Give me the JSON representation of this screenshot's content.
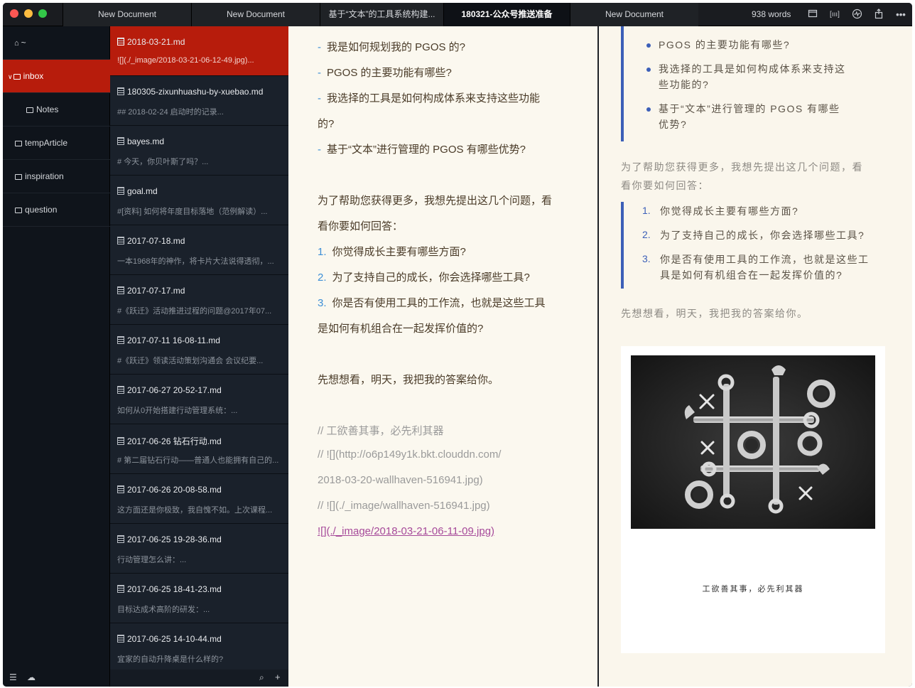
{
  "tabs": [
    {
      "label": "New Document"
    },
    {
      "label": "New Document"
    },
    {
      "label": "基于“文本”的工具系统构建..."
    },
    {
      "label": "180321-公众号推送准备"
    },
    {
      "label": "New Document"
    }
  ],
  "toolbar": {
    "word_count": "938 words",
    "icons": [
      "window-icon",
      "brackets-icon",
      "activity-icon",
      "share-icon",
      "more-icon"
    ]
  },
  "folders": [
    {
      "label": "~",
      "icon": "home-icon"
    },
    {
      "label": "inbox",
      "icon": "folder-icon"
    },
    {
      "label": "Notes",
      "icon": "folder-icon"
    },
    {
      "label": "tempArticle",
      "icon": "folder-icon"
    },
    {
      "label": "inspiration",
      "icon": "folder-icon"
    },
    {
      "label": "question",
      "icon": "folder-icon"
    }
  ],
  "files": [
    {
      "name": "2018-03-21.md",
      "snippet": "![](./_image/2018-03-21-06-12-49.jpg)..."
    },
    {
      "name": "180305-zixunhuashu-by-xuebao.md",
      "snippet": "## 2018-02-24 启动时的记录..."
    },
    {
      "name": "bayes.md",
      "snippet": "# 今天，你贝叶斯了吗？..."
    },
    {
      "name": "goal.md",
      "snippet": "#[资料] 如何将年度目标落地（范例解读）..."
    },
    {
      "name": "2017-07-18.md",
      "snippet": "一本1968年的神作，将卡片大法说得透彻，..."
    },
    {
      "name": "2017-07-17.md",
      "snippet": "#《跃迁》活动推进过程的问题@2017年07..."
    },
    {
      "name": "2017-07-11 16-08-11.md",
      "snippet": "#《跃迁》领读活动策划沟通会 会议纪要..."
    },
    {
      "name": "2017-06-27 20-52-17.md",
      "snippet": "如何从0开始搭建行动管理系统：..."
    },
    {
      "name": "2017-06-26 钻石行动.md",
      "snippet": "# 第二届钻石行动——普通人也能拥有自己的..."
    },
    {
      "name": "2017-06-26 20-08-58.md",
      "snippet": "这方面还是你极致，我自愧不如。上次课程..."
    },
    {
      "name": "2017-06-25 19-28-36.md",
      "snippet": "行动管理怎么讲：..."
    },
    {
      "name": "2017-06-25 18-41-23.md",
      "snippet": "目标达成术高阶的研发：..."
    },
    {
      "name": "2017-06-25 14-10-44.md",
      "snippet": "宜家的自动升降桌是什么样的?"
    }
  ],
  "editor": {
    "lines": [
      {
        "mark": "-",
        "text": "我是如何规划我的 PGOS 的?"
      },
      {
        "mark": "-",
        "text": "PGOS 的主要功能有哪些?"
      },
      {
        "mark": "-",
        "text": "我选择的工具是如何构成体系来支持这些功能"
      },
      {
        "mark": "",
        "text": "的?"
      },
      {
        "mark": "-",
        "text": "基于“文本”进行管理的 PGOS 有哪些优势?"
      },
      {
        "mark": "",
        "text": "为了帮助您获得更多，我想先提出这几个问题，看"
      },
      {
        "mark": "",
        "text": "看你要如何回答："
      },
      {
        "mark": "1.",
        "text": "你觉得成长主要有哪些方面?"
      },
      {
        "mark": "2.",
        "text": "为了支持自己的成长，你会选择哪些工具?"
      },
      {
        "mark": "3.",
        "text": "你是否有使用工具的工作流，也就是这些工具"
      },
      {
        "mark": "",
        "text": "是如何有机组合在一起发挥价值的?"
      },
      {
        "mark": "",
        "text": "先想想看，明天，我把我的答案给你。"
      },
      {
        "mark": "",
        "text": "// 工欲善其事，必先利其器"
      },
      {
        "mark": "",
        "text": "// ![](http://o6p149y1k.bkt.clouddn.com/"
      },
      {
        "mark": "",
        "text": "2018-03-20-wallhaven-516941.jpg)"
      },
      {
        "mark": "",
        "text": "// ![](./_image/wallhaven-516941.jpg)"
      },
      {
        "mark": "",
        "text": "![](./_image/2018-03-21-06-11-09.jpg)"
      }
    ]
  },
  "preview": {
    "bullets": [
      "PGOS 的主要功能有哪些?",
      "我选择的工具是如何构成体系来支持这",
      "些功能的?",
      "基于“文本”进行管理的 PGOS 有哪些",
      "优势?"
    ],
    "intro_line1": "为了帮助您获得更多，我想先提出这几个问题，看",
    "intro_line2": "看你要如何回答：",
    "questions": [
      {
        "num": "1.",
        "text": "你觉得成长主要有哪些方面?"
      },
      {
        "num": "2.",
        "text": "为了支持自己的成长，你会选择哪些工具?"
      },
      {
        "num": "3.",
        "text": "你是否有使用工具的工作流，也就是这些工"
      },
      {
        "num": "",
        "text": "具是如何有机组合在一起发挥价值的?"
      }
    ],
    "closing": "先想想看，明天，我把我的答案给你。",
    "caption": "工欲善其事，必先利其器"
  },
  "colors": {
    "accent_red": "#b71c0c",
    "editor_bg": "#fbf8ef",
    "quote_blue": "#3c5fb8",
    "list_marker_blue": "#3d8fd6"
  }
}
